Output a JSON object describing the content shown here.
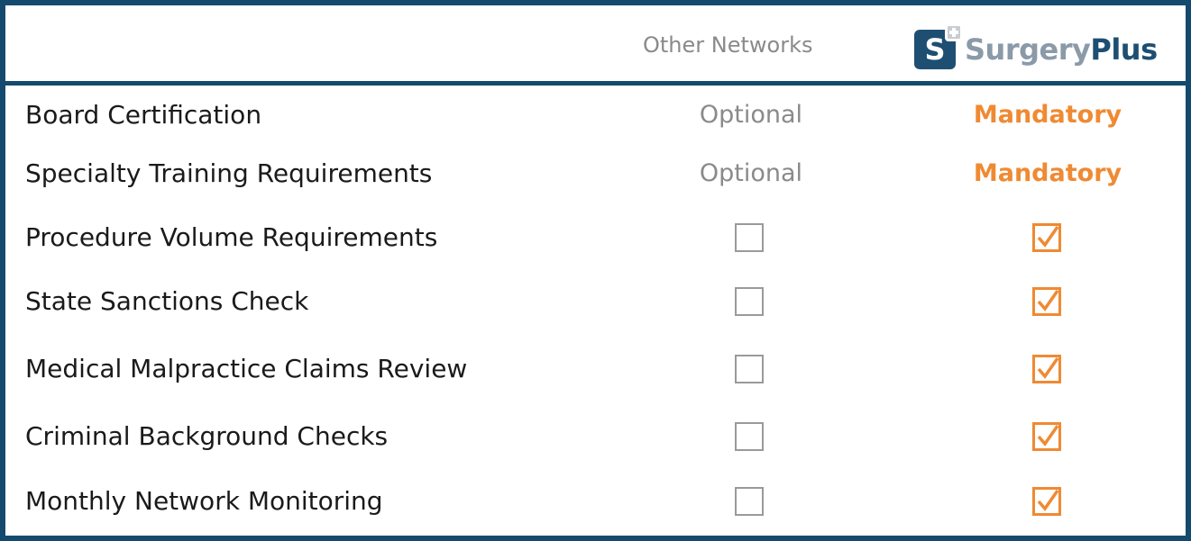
{
  "colors": {
    "frame": "#144a6e",
    "accent": "#ef8a33",
    "muted": "#8a8a8a",
    "brand_dark": "#1e4f72",
    "brand_light": "#8a9aa8"
  },
  "header": {
    "other_networks": "Other Networks",
    "logo": {
      "mark_letter": "S",
      "word_surgery": "Surgery",
      "word_plus": "Plus"
    }
  },
  "rows": [
    {
      "label": "Board Certification",
      "other": "Optional",
      "surgeryplus": "Mandatory"
    },
    {
      "label": "Specialty Training Requirements",
      "other": "Optional",
      "surgeryplus": "Mandatory"
    },
    {
      "label": "Procedure Volume Requirements",
      "other_icon": "empty-checkbox-icon",
      "surgeryplus_icon": "checked-checkbox-icon"
    },
    {
      "label": "State Sanctions Check",
      "other_icon": "empty-checkbox-icon",
      "surgeryplus_icon": "checked-checkbox-icon"
    },
    {
      "label": "Medical Malpractice Claims Review",
      "other_icon": "empty-checkbox-icon",
      "surgeryplus_icon": "checked-checkbox-icon"
    },
    {
      "label": "Criminal Background Checks",
      "other_icon": "empty-checkbox-icon",
      "surgeryplus_icon": "checked-checkbox-icon"
    },
    {
      "label": "Monthly Network Monitoring",
      "other_icon": "empty-checkbox-icon",
      "surgeryplus_icon": "checked-checkbox-icon"
    }
  ]
}
